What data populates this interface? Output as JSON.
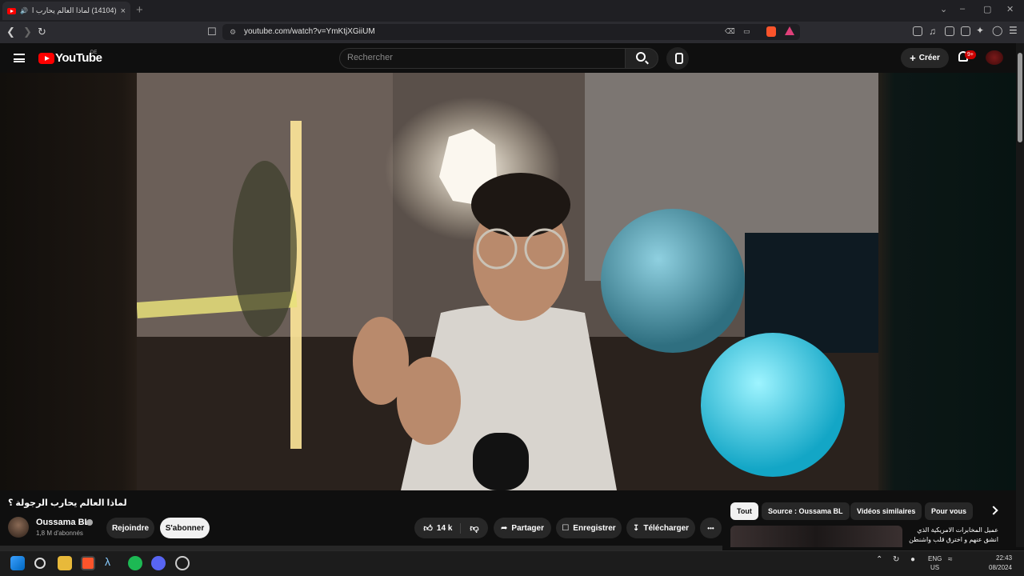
{
  "browser": {
    "tab_title": "(14104) لماذا العالم يحارب الرجـ",
    "tab_close": "×",
    "new_tab": "+",
    "url": "youtube.com/watch?v=YmKtjXGiiUM",
    "window_controls": [
      "⌄",
      "–",
      "▢",
      "✕"
    ]
  },
  "header": {
    "logo_text": "YouTube",
    "region": "DE",
    "search_placeholder": "Rechercher",
    "create_label": "Créer",
    "notifications_badge": "9+"
  },
  "video": {
    "title": "لماذا العالم يحارب الرجولة ؟",
    "channel_name": "Oussama BL",
    "subscribers": "1,8 M d'abonnés",
    "join_label": "Rejoindre",
    "subscribe_label": "S'abonner",
    "likes": "14 k",
    "share_label": "Partager",
    "save_label": "Enregistrer",
    "download_label": "Télécharger",
    "more_label": "•••"
  },
  "recommendations": {
    "chips": [
      "Tout",
      "Source : Oussama BL",
      "Vidéos similaires",
      "Pour vous"
    ],
    "first_title": "عميل المخابرات الامريكية الذي انشق عنهم و اخترق قلب واشنطن"
  },
  "taskbar": {
    "lang": "ENG",
    "region": "US",
    "time": "22:43",
    "date": "08/2024"
  }
}
